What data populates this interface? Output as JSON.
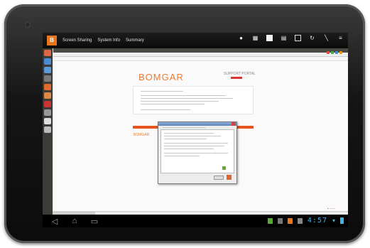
{
  "actionbar": {
    "tabs": [
      "Screen Sharing",
      "System Info",
      "Summary"
    ]
  },
  "remote_page": {
    "logo_text": "BOMGAR",
    "portal_text": "SUPPORT PORTAL",
    "small_logo_text": "BOMGAR"
  },
  "system_bar": {
    "clock": "4:57"
  },
  "colors": {
    "accent": "#e8761f",
    "clock": "#3fb6e8",
    "brand": "#ee7a30"
  },
  "icons": [
    "bomgar-app-icon",
    "chat-icon",
    "keyboard-icon",
    "stop-icon",
    "clipboard-icon",
    "save-icon",
    "refresh-icon",
    "tools-icon",
    "menu-icon",
    "back-icon",
    "home-icon",
    "recent-apps-icon"
  ]
}
